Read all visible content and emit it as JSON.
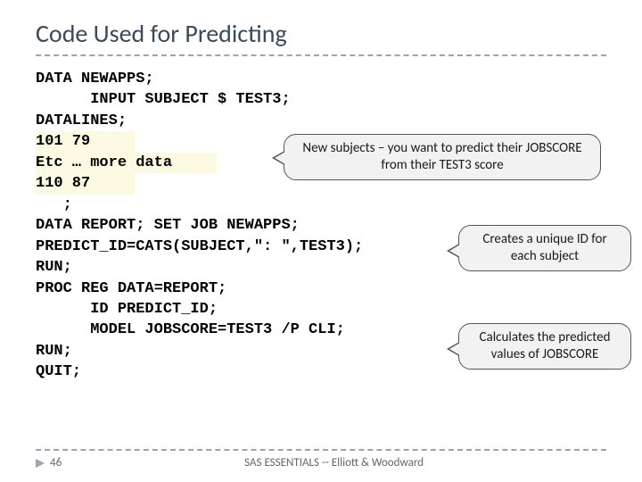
{
  "title": "Code Used for Predicting",
  "code": {
    "l1": "DATA NEWAPPS;",
    "l2": "      INPUT SUBJECT $ TEST3;",
    "l3": "DATALINES;",
    "l4": "101 79",
    "l5": "Etc … more data",
    "l6": "110 87",
    "l7": "   ;",
    "l8": "DATA REPORT; SET JOB NEWAPPS;",
    "l9": "PREDICT_ID=CATS(SUBJECT,\": \",TEST3);",
    "l10": "RUN;",
    "l11": "PROC REG DATA=REPORT;",
    "l12": "      ID PREDICT_ID;",
    "l13": "      MODEL JOBSCORE=TEST3 /P CLI;",
    "l14": "RUN;",
    "l15": "QUIT;"
  },
  "callouts": {
    "c1": "New subjects – you want to predict their JOBSCORE from their TEST3 score",
    "c2": "Creates a unique ID for each subject",
    "c3": "Calculates the predicted values of JOBSCORE"
  },
  "footer": {
    "page": "46",
    "center": "SAS ESSENTIALS -- Elliott & Woodward"
  }
}
